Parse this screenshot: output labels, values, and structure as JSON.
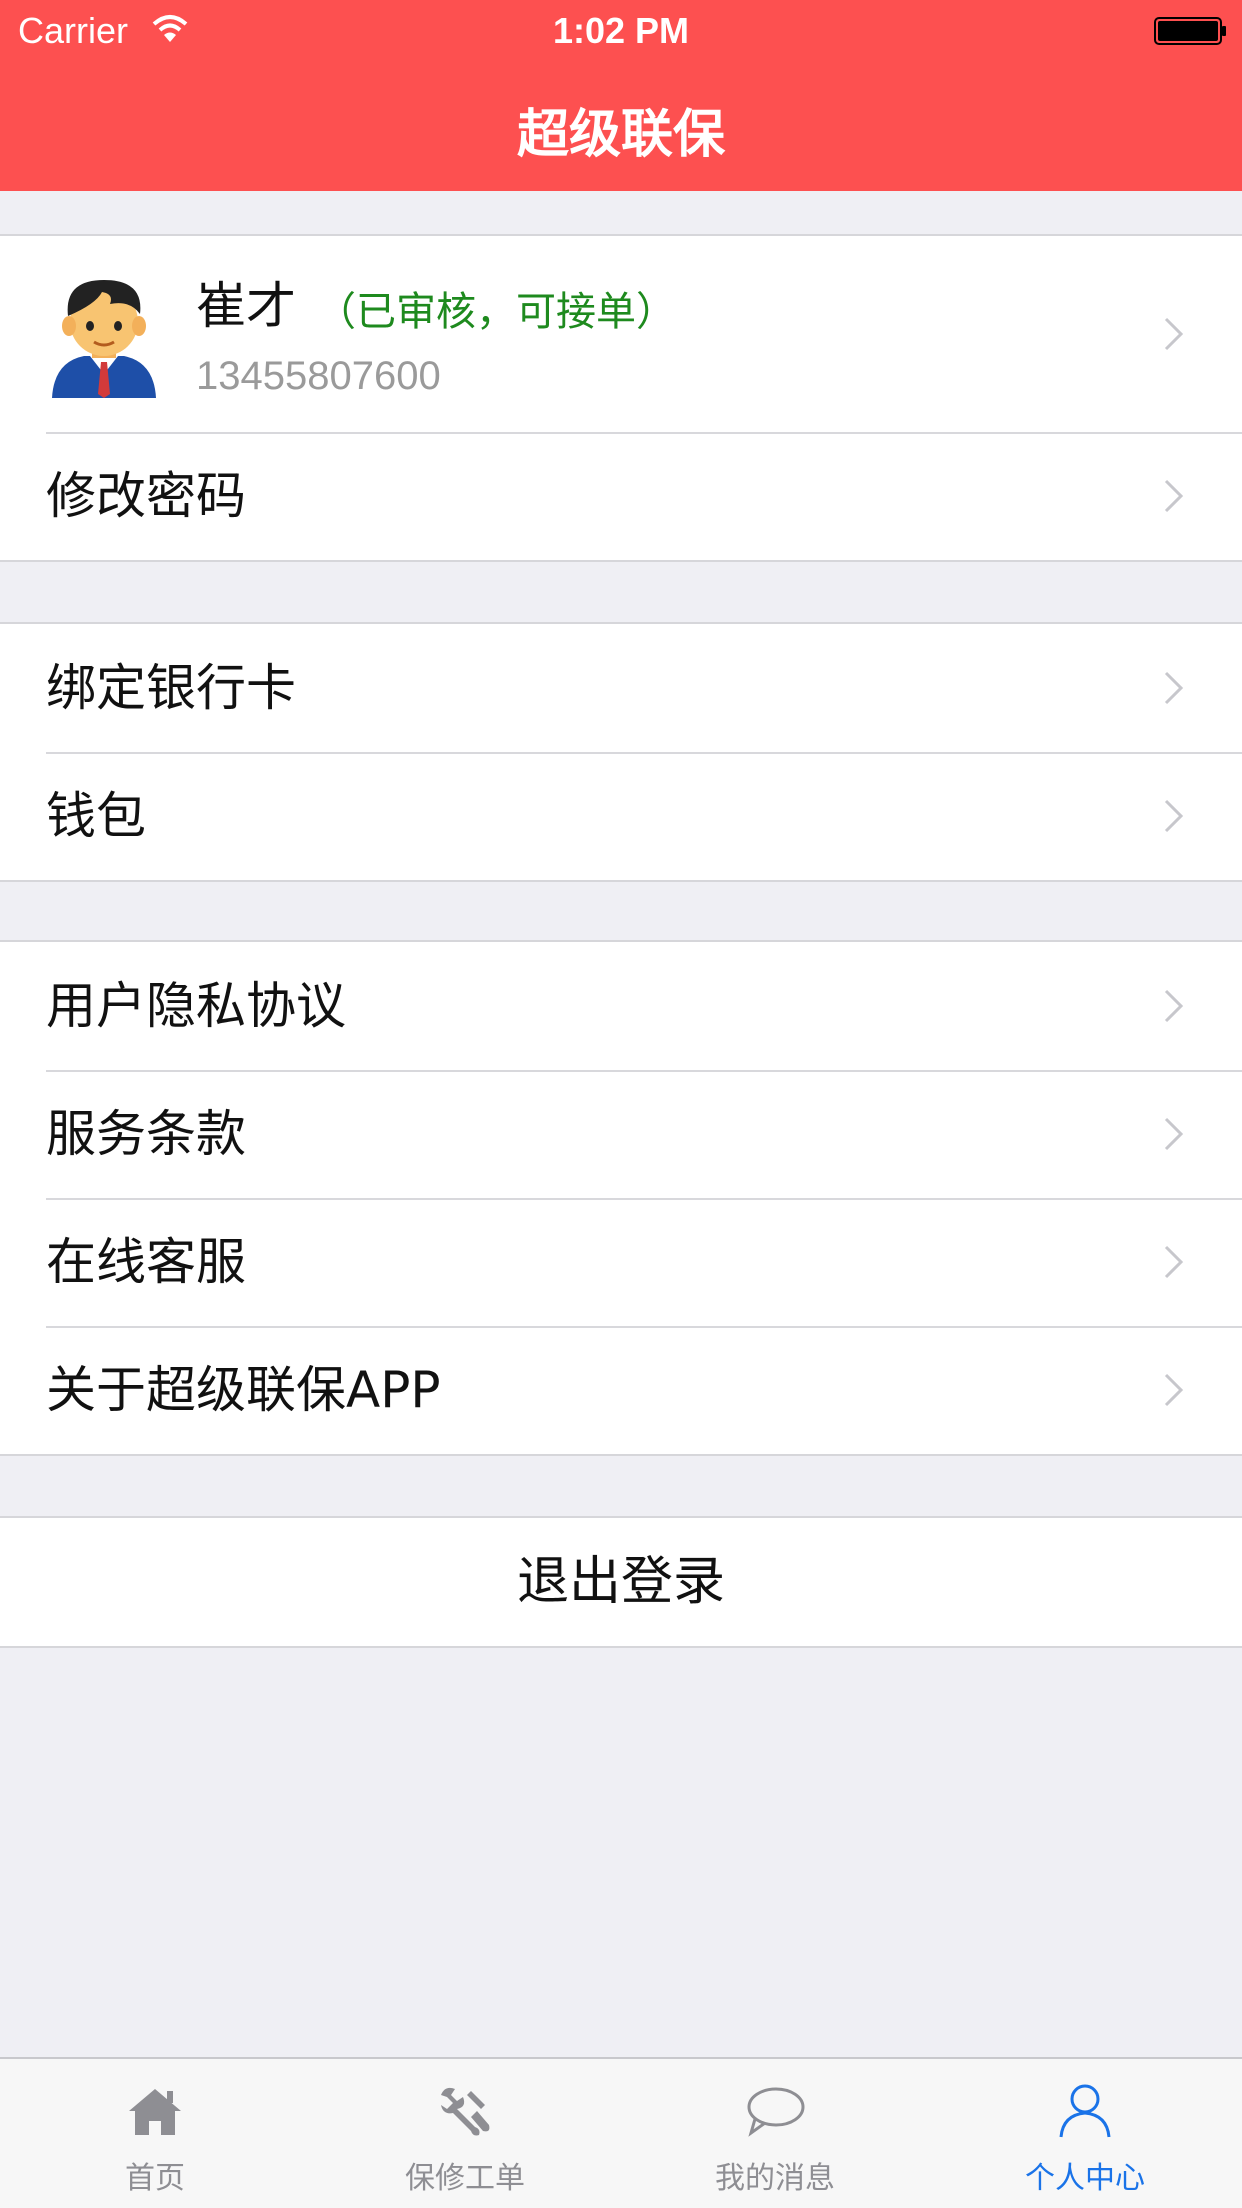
{
  "status_bar": {
    "carrier": "Carrier",
    "time": "1:02 PM"
  },
  "header": {
    "title": "超级联保",
    "background_color": "#fd5050"
  },
  "profile": {
    "name": "崔才",
    "status": "（已审核，可接单）",
    "phone": "13455807600",
    "status_color": "#1e8a1e"
  },
  "menu": {
    "change_password": "修改密码",
    "bind_bank_card": "绑定银行卡",
    "wallet": "钱包",
    "privacy_agreement": "用户隐私协议",
    "terms_of_service": "服务条款",
    "online_support": "在线客服",
    "about_app": "关于超级联保APP"
  },
  "logout_label": "退出登录",
  "tabbar": {
    "items": [
      {
        "label": "首页",
        "icon": "home-icon"
      },
      {
        "label": "保修工单",
        "icon": "repair-tools-icon"
      },
      {
        "label": "我的消息",
        "icon": "chat-bubble-icon"
      },
      {
        "label": "个人中心",
        "icon": "person-icon",
        "active": true
      }
    ],
    "active_color": "#1a73e8"
  }
}
